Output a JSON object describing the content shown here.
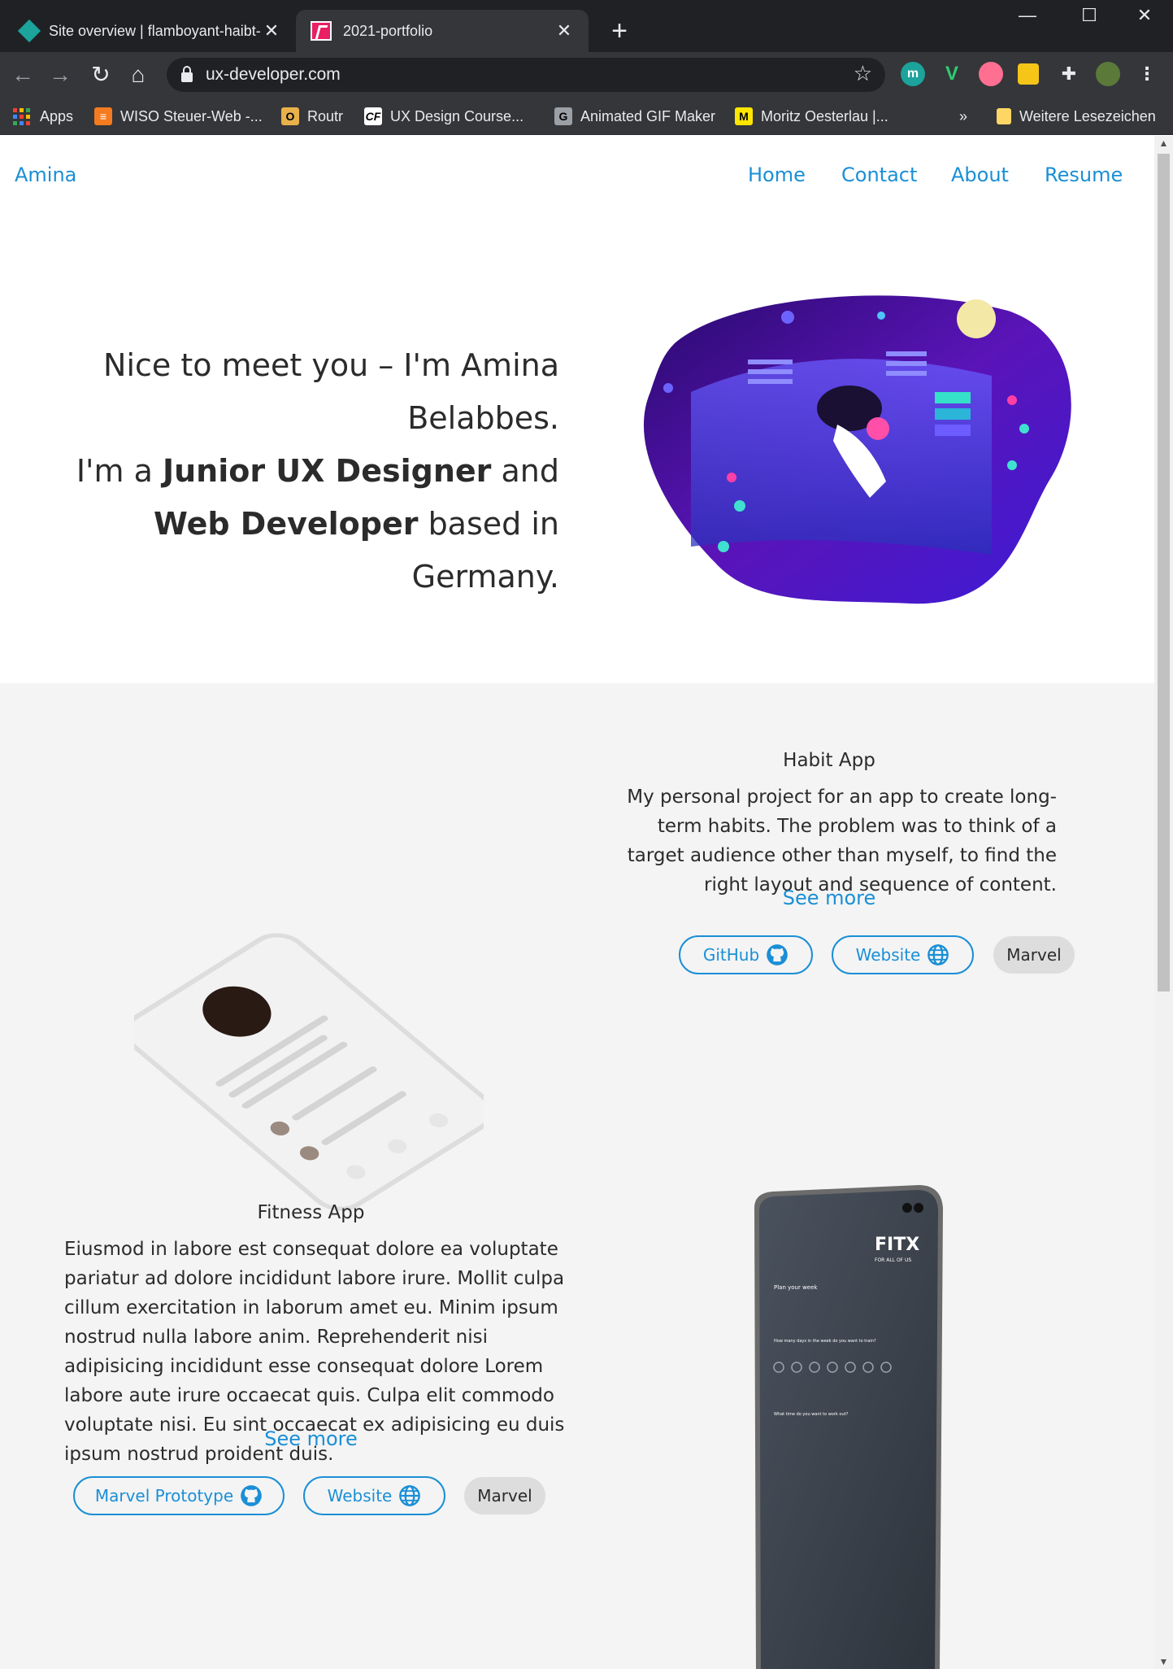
{
  "browser": {
    "tabs": [
      {
        "title": "Site overview | flamboyant-haibt-",
        "active": false
      },
      {
        "title": "2021-portfolio",
        "active": true
      }
    ],
    "new_tab": "+",
    "url": "ux-developer.com",
    "window_controls": {
      "minimize": "—",
      "maximize": "☐",
      "close": "✕"
    },
    "extensions": [
      "m",
      "V"
    ],
    "bookmarks": [
      {
        "label": "Apps"
      },
      {
        "label": "WISO Steuer-Web -..."
      },
      {
        "label": "Routr"
      },
      {
        "label": "UX Design Course..."
      },
      {
        "label": "Animated GIF Maker"
      },
      {
        "label": "Moritz Oesterlau |..."
      }
    ],
    "bookmarks_overflow": "»",
    "other_bookmarks": "Weitere Lesezeichen"
  },
  "site": {
    "brand": "Amina",
    "nav": [
      "Home",
      "Contact",
      "About",
      "Resume"
    ],
    "hero": {
      "line1": "Nice to meet you – I'm Amina Belabbes.",
      "line2_prefix": "I'm a ",
      "role1": "Junior UX Designer",
      "line2_mid": " and ",
      "role2": "Web Developer",
      "line2_suffix": " based in Germany."
    },
    "projects": [
      {
        "title": "Habit App",
        "description": "My personal project for an app to create long-term habits. The problem was to think of a target audience other than myself, to find the right layout and sequence of content.",
        "see_more": "See more",
        "links": [
          "GitHub",
          "Website"
        ],
        "tag": "Marvel"
      },
      {
        "title": "Fitness App",
        "description": "Eiusmod in labore est consequat dolore ea voluptate pariatur ad dolore incididunt labore irure. Mollit culpa cillum exercitation in laborum amet eu. Minim ipsum nostrud nulla labore anim. Reprehenderit nisi adipisicing incididunt esse consequat dolore Lorem labore aute irure occaecat quis. Culpa elit commodo voluptate nisi. Eu sint occaecat ex adipisicing eu duis ipsum nostrud proident duis.",
        "see_more": "See more",
        "links": [
          "Marvel Prototype",
          "Website"
        ],
        "tag": "Marvel"
      }
    ],
    "fitx": {
      "logo": "FITX",
      "tagline": "FOR ALL OF US",
      "heading": "Plan your week",
      "q1": "How many days in the week do you want to train?",
      "q2": "What time do you want to work out?"
    }
  },
  "colors": {
    "accent": "#1a8fd6",
    "text": "#2b2b2b",
    "section_bg": "#f4f4f4",
    "pill_grey": "#dddddd"
  }
}
